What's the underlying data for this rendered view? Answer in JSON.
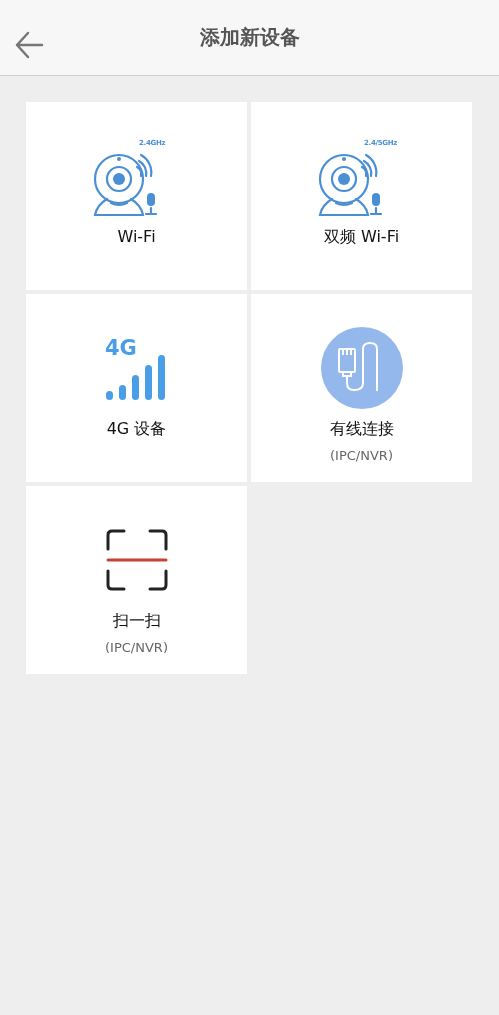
{
  "header": {
    "title": "添加新设备"
  },
  "options": [
    {
      "kind": "camera",
      "badge": "2.4GHz",
      "label": "Wi-Fi"
    },
    {
      "kind": "camera",
      "badge": "2.4/5GHz",
      "label": "双频 Wi-Fi"
    },
    {
      "kind": "signal",
      "badge": "4G",
      "label": "4G 设备"
    },
    {
      "kind": "wired",
      "label": "有线连接",
      "sublabel": "(IPC/NVR)"
    },
    {
      "kind": "scan",
      "label": "扫一扫",
      "sublabel": "(IPC/NVR)"
    }
  ]
}
